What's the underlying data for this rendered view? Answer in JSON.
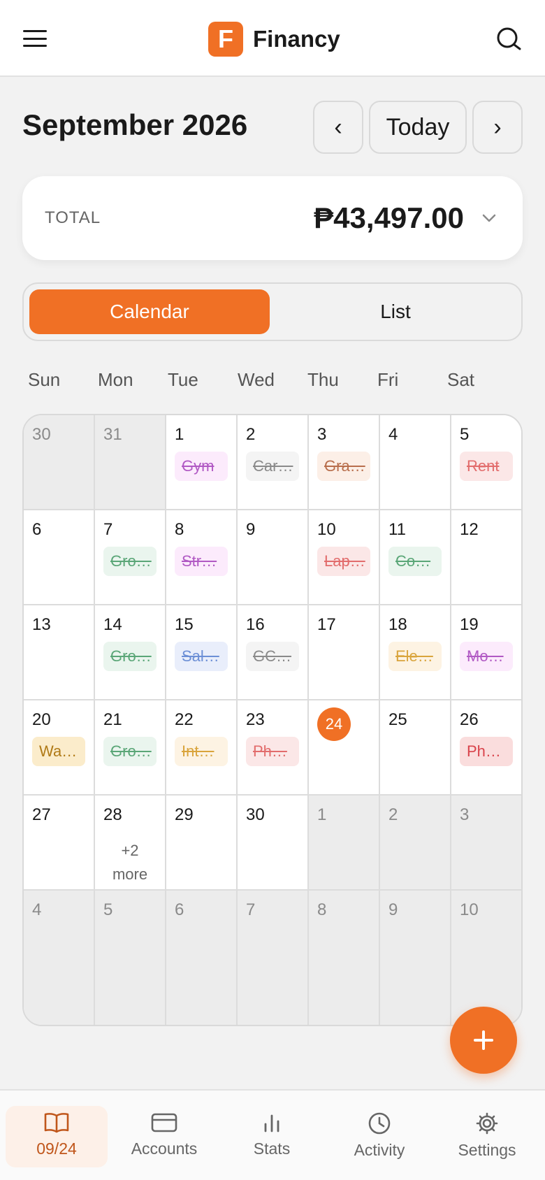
{
  "app": {
    "name": "Financy",
    "logo_letter": "F"
  },
  "header": {
    "month_title": "September 2026",
    "prev_label": "‹",
    "today_label": "Today",
    "next_label": "›"
  },
  "total": {
    "label": "TOTAL",
    "amount": "₱43,497.00"
  },
  "view_toggle": {
    "calendar_label": "Calendar",
    "list_label": "List",
    "selected": "Calendar"
  },
  "weekdays": [
    "Sun",
    "Mon",
    "Tue",
    "Wed",
    "Thu",
    "Fri",
    "Sat"
  ],
  "calendar": {
    "today": "24",
    "cells": [
      {
        "day": "30",
        "out": true
      },
      {
        "day": "31",
        "out": true
      },
      {
        "day": "1",
        "chip": {
          "text": "Gym",
          "done": true,
          "color": "#b159c4",
          "bg": "#fcebfc"
        }
      },
      {
        "day": "2",
        "chip": {
          "text": "Car…",
          "done": true,
          "color": "#8a8a8a",
          "bg": "#f4f4f4"
        }
      },
      {
        "day": "3",
        "chip": {
          "text": "Gra…",
          "done": true,
          "color": "#b86e4c",
          "bg": "#fcefe7"
        }
      },
      {
        "day": "4"
      },
      {
        "day": "5",
        "chip": {
          "text": "Rent",
          "done": true,
          "color": "#e26c6c",
          "bg": "#fbe7e7"
        }
      },
      {
        "day": "6"
      },
      {
        "day": "7",
        "chip": {
          "text": "Gro…",
          "done": true,
          "color": "#5aa677",
          "bg": "#eaf5ee"
        }
      },
      {
        "day": "8",
        "chip": {
          "text": "Str…",
          "done": true,
          "color": "#b159c4",
          "bg": "#fcebfc"
        }
      },
      {
        "day": "9"
      },
      {
        "day": "10",
        "chip": {
          "text": "Lap…",
          "done": true,
          "color": "#e26c6c",
          "bg": "#fbe7e7"
        }
      },
      {
        "day": "11",
        "chip": {
          "text": "Co…",
          "done": true,
          "color": "#5aa677",
          "bg": "#eaf5ee"
        }
      },
      {
        "day": "12"
      },
      {
        "day": "13"
      },
      {
        "day": "14",
        "chip": {
          "text": "Gro…",
          "done": true,
          "color": "#5aa677",
          "bg": "#eaf5ee"
        }
      },
      {
        "day": "15",
        "chip": {
          "text": "Sal…",
          "done": true,
          "color": "#6c8fd6",
          "bg": "#e9eefb"
        }
      },
      {
        "day": "16",
        "chip": {
          "text": "GC…",
          "done": true,
          "color": "#8a8a8a",
          "bg": "#f4f4f4"
        }
      },
      {
        "day": "17"
      },
      {
        "day": "18",
        "chip": {
          "text": "Ele…",
          "done": true,
          "color": "#d9a43c",
          "bg": "#fdf3e3"
        }
      },
      {
        "day": "19",
        "chip": {
          "text": "Mo…",
          "done": true,
          "color": "#b159c4",
          "bg": "#fcebfc"
        }
      },
      {
        "day": "20",
        "chip": {
          "text": "Wa…",
          "done": false,
          "color": "#b07a16",
          "bg": "#fbeccb"
        }
      },
      {
        "day": "21",
        "chip": {
          "text": "Gro…",
          "done": true,
          "color": "#5aa677",
          "bg": "#eaf5ee"
        }
      },
      {
        "day": "22",
        "chip": {
          "text": "Int…",
          "done": true,
          "color": "#d9a43c",
          "bg": "#fdf3e3"
        }
      },
      {
        "day": "23",
        "chip": {
          "text": "Ph…",
          "done": true,
          "color": "#e26c6c",
          "bg": "#fbe7e7"
        }
      },
      {
        "day": "24",
        "today": true
      },
      {
        "day": "25"
      },
      {
        "day": "26",
        "chip": {
          "text": "Ph…",
          "done": false,
          "color": "#d9434b",
          "bg": "#fadddd"
        }
      },
      {
        "day": "27"
      },
      {
        "day": "28",
        "more": "+2 more"
      },
      {
        "day": "29"
      },
      {
        "day": "30"
      },
      {
        "day": "1",
        "out": true
      },
      {
        "day": "2",
        "out": true
      },
      {
        "day": "3",
        "out": true
      },
      {
        "day": "4",
        "out": true
      },
      {
        "day": "5",
        "out": true
      },
      {
        "day": "6",
        "out": true
      },
      {
        "day": "7",
        "out": true
      },
      {
        "day": "8",
        "out": true
      },
      {
        "day": "9",
        "out": true
      },
      {
        "day": "10",
        "out": true
      }
    ]
  },
  "bottom_nav": {
    "items": [
      {
        "label": "09/24",
        "icon": "book-icon",
        "active": true
      },
      {
        "label": "Accounts",
        "icon": "card-icon"
      },
      {
        "label": "Stats",
        "icon": "bar-chart-icon"
      },
      {
        "label": "Activity",
        "icon": "clock-icon"
      },
      {
        "label": "Settings",
        "icon": "gear-icon"
      }
    ]
  },
  "colors": {
    "accent": "#f07025",
    "background": "#f2f2f2",
    "surface": "#ffffff"
  }
}
